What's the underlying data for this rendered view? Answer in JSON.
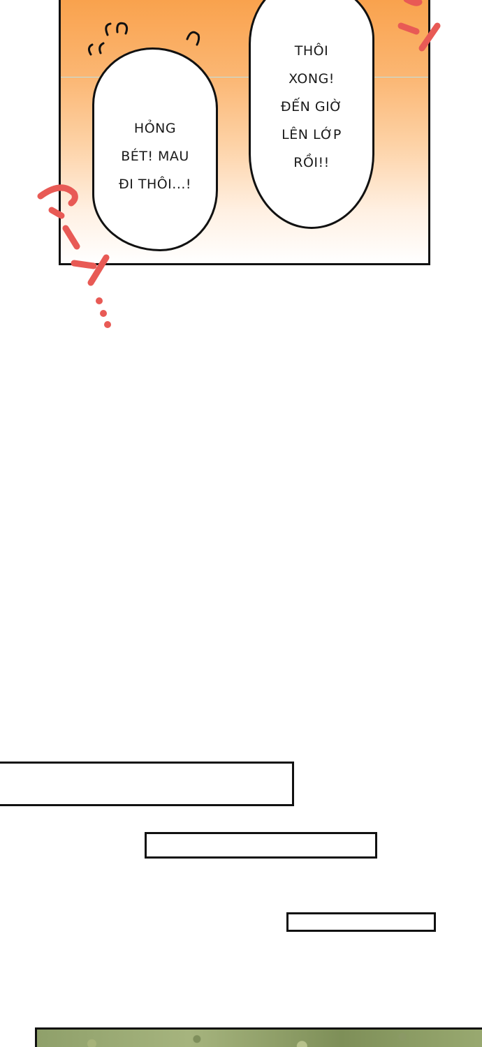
{
  "panel_top": {
    "bubble_left_text": "HỎNG\nBÉT! MAU\nĐI THÔI...!",
    "bubble_right_text": "THÔI\nXONG!\nĐẾN GIỜ\nLÊN LỚP\nRỒI!!"
  },
  "colors": {
    "background": "#ffffff",
    "panel_gradient_top": "#f9a24d",
    "panel_gradient_bottom": "#ffffff",
    "outline": "#111111",
    "sfx_red": "#e85a55",
    "forest_green": "#8fa06a"
  },
  "icons": [
    "sweat-drop-icon",
    "motion-line-icon"
  ]
}
